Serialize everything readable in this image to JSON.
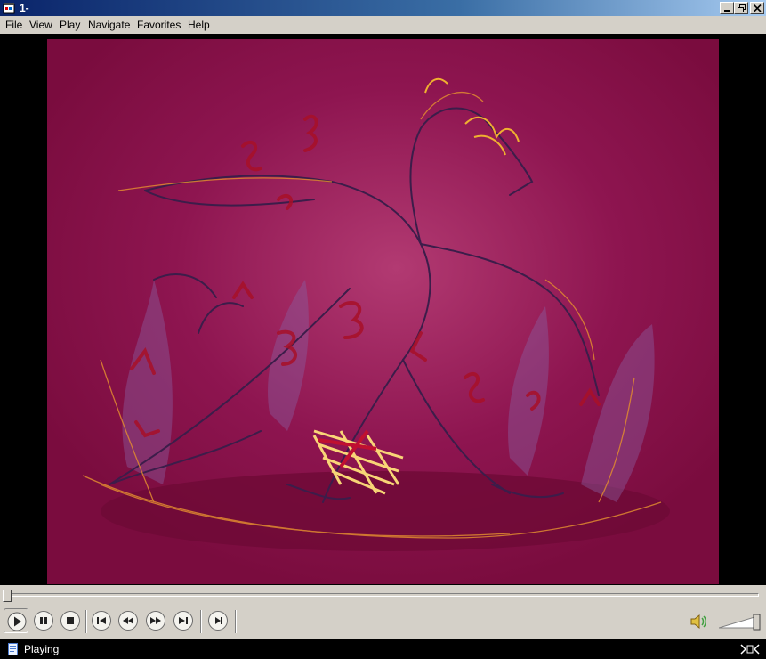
{
  "window": {
    "title": "1-"
  },
  "menu": {
    "items": [
      "File",
      "View",
      "Play",
      "Navigate",
      "Favorites",
      "Help"
    ]
  },
  "playback": {
    "seek_fraction": 0.0,
    "volume_fraction": 1.0
  },
  "statusbar": {
    "text": "Playing"
  },
  "colors": {
    "titlebar": "#0a246a",
    "chrome": "#d4d0c8",
    "video_bg": "#7d0e42"
  },
  "icons": {
    "controls": [
      "play-icon",
      "pause-icon",
      "stop-icon",
      "skip-back-icon",
      "rewind-icon",
      "fast-forward-icon",
      "skip-forward-icon",
      "frame-step-icon"
    ],
    "other": [
      "speaker-icon",
      "fullscreen-icon"
    ]
  }
}
